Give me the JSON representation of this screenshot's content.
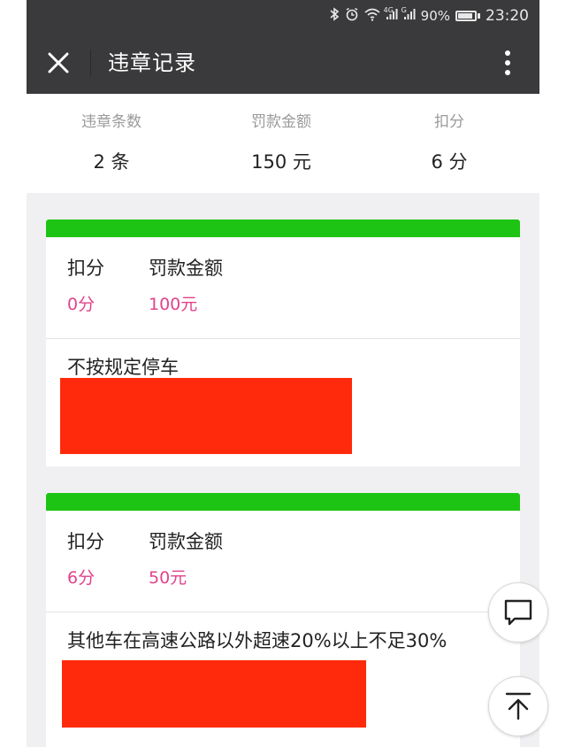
{
  "status_bar": {
    "icons": [
      "bluetooth-icon",
      "alarm-icon",
      "wifi-icon",
      "signal-4g-icon",
      "signal-icon",
      "battery-icon"
    ],
    "network_tag": "4G",
    "sim_tag": "G",
    "battery": "90%",
    "time": "23:20"
  },
  "header": {
    "title": "违章记录",
    "close_icon": "close-icon",
    "more_icon": "more-vertical-icon"
  },
  "summary": {
    "count_label": "违章条数",
    "count_value": "2 条",
    "fine_label": "罚款金额",
    "fine_value": "150 元",
    "points_label": "扣分",
    "points_value": "6 分"
  },
  "records": [
    {
      "points_label": "扣分",
      "fine_label": "罚款金额",
      "points_value": "0分",
      "fine_value": "100元",
      "description": "不按规定停车"
    },
    {
      "points_label": "扣分",
      "fine_label": "罚款金额",
      "points_value": "6分",
      "fine_value": "50元",
      "description": "其他车在高速公路以外超速20%以上不足30%"
    }
  ],
  "colors": {
    "header_bg": "#3a3a3c",
    "card_accent": "#1ec413",
    "value_pink": "#e0438b",
    "redaction": "#ff2a0c",
    "page_bg": "#f0f0f2"
  },
  "floating_buttons": [
    "comment-icon",
    "back-to-top-icon"
  ]
}
